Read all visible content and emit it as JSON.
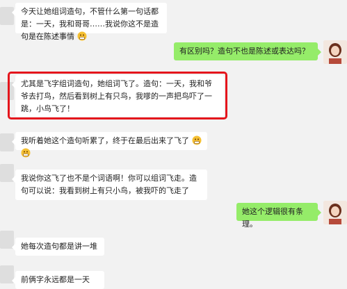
{
  "messages": [
    {
      "side": "left",
      "text": "今天让她组词造句，不管什么第一句话都是：一天，我和哥哥……我说你这不是造句是在陈述事情"
    },
    {
      "side": "right",
      "text": "有区别吗？造句不也是陈述或表达吗？"
    },
    {
      "side": "left",
      "text": "尤其是飞字组词造句，她组词飞了。造句：一天，我和爷爷去打鸟，然后看到树上有只鸟，我嗲的一声把鸟吓了一跳，小鸟飞了！"
    },
    {
      "side": "left",
      "text": "我听着她这个造句听累了，终于在最后出来了飞了"
    },
    {
      "side": "left",
      "text": "我说你这飞了也不是个词语啊！你可以组词飞走。造句可以说：我看到树上有只小鸟，被我吓的飞走了"
    },
    {
      "side": "right",
      "text": "她这个逻辑很有条理。"
    },
    {
      "side": "left",
      "text": "她每次造句都是讲一堆"
    },
    {
      "side": "left",
      "text": "前俩字永远都是一天"
    }
  ],
  "colors": {
    "highlight": "#e4151c",
    "right_bubble": "#95ec69",
    "left_bubble": "#ffffff"
  },
  "icons": {
    "emoji": "grimace-emoji"
  }
}
